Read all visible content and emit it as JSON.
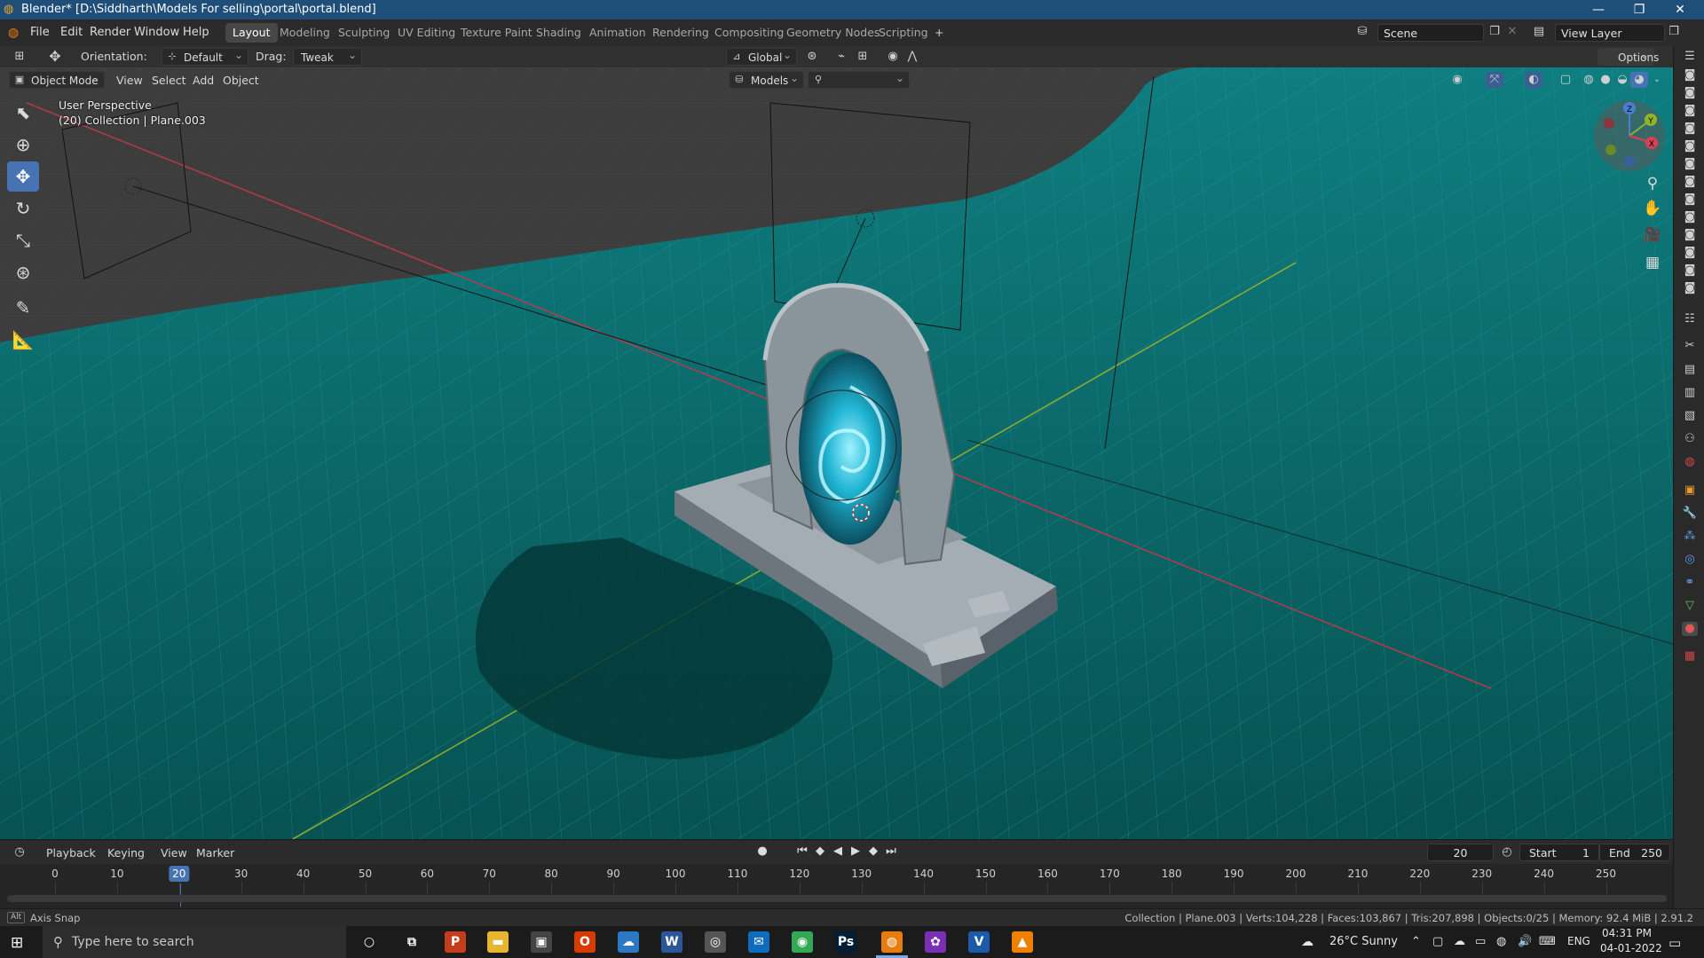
{
  "window": {
    "title": "Blender* [D:\\Siddharth\\Models For selling\\portal\\portal.blend]",
    "controls": [
      "—",
      "❐",
      "✕"
    ]
  },
  "menu": [
    "File",
    "Edit",
    "Render",
    "Window",
    "Help"
  ],
  "workspaces": [
    "Layout",
    "Modeling",
    "Sculpting",
    "UV Editing",
    "Texture Paint",
    "Shading",
    "Animation",
    "Rendering",
    "Compositing",
    "Geometry Nodes",
    "Scripting",
    "+"
  ],
  "active_workspace": "Layout",
  "scene": {
    "name": "Scene",
    "view_layer": "View Layer"
  },
  "header": {
    "orientation_label": "Orientation:",
    "orientation_value": "Default",
    "drag_label": "Drag:",
    "drag_value": "Tweak",
    "transform_space": "Global",
    "options": "Options"
  },
  "viewport_header": {
    "mode": "Object Mode",
    "menus": [
      "View",
      "Select",
      "Add",
      "Object"
    ],
    "collection_filter": "Models"
  },
  "viewport": {
    "view_name": "User Perspective",
    "context": "(20) Collection | Plane.003",
    "floor_color": "#0b6b6b",
    "background_color": "#3d3d3d",
    "portal_glow_color": "#33c6e0",
    "stone_color": "#8f9aa0"
  },
  "gizmo": {
    "x": "X",
    "y": "Y",
    "z": "Z"
  },
  "timeline": {
    "menus": [
      "Playback",
      "Keying",
      "View",
      "Marker"
    ],
    "current_frame": "20",
    "start_label": "Start",
    "start": "1",
    "end_label": "End",
    "end": "250",
    "ticks": [
      "0",
      "10",
      "20",
      "30",
      "40",
      "50",
      "60",
      "70",
      "80",
      "90",
      "100",
      "110",
      "120",
      "130",
      "140",
      "150",
      "160",
      "170",
      "180",
      "190",
      "200",
      "210",
      "220",
      "230",
      "240",
      "250"
    ]
  },
  "status": {
    "left_key": "Alt",
    "left": "Axis Snap",
    "right": "Collection | Plane.003 | Verts:104,228 | Faces:103,867 | Tris:207,898 | Objects:0/25 | Memory: 92.4 MiB | 2.91.2"
  },
  "taskbar": {
    "search_placeholder": "Type here to search",
    "apps": [
      {
        "name": "cortana-icon",
        "glyph": "○",
        "color": "#1b1b1b"
      },
      {
        "name": "task-view-icon",
        "glyph": "⧉",
        "color": "#1b1b1b"
      },
      {
        "name": "powerpoint-icon",
        "glyph": "P",
        "color": "#c43e1c"
      },
      {
        "name": "file-explorer-icon",
        "glyph": "▬",
        "color": "#e8b530"
      },
      {
        "name": "store-icon",
        "glyph": "▣",
        "color": "#444444"
      },
      {
        "name": "office-icon",
        "glyph": "O",
        "color": "#d83b01"
      },
      {
        "name": "feedback-icon",
        "glyph": "☁",
        "color": "#2b79c2"
      },
      {
        "name": "word-icon",
        "glyph": "W",
        "color": "#2b579a"
      },
      {
        "name": "app-icon",
        "glyph": "◎",
        "color": "#555555"
      },
      {
        "name": "mail-icon",
        "glyph": "✉",
        "color": "#0f6cbd"
      },
      {
        "name": "chrome-icon",
        "glyph": "◉",
        "color": "#34a853"
      },
      {
        "name": "photoshop-icon",
        "glyph": "Ps",
        "color": "#001e36"
      },
      {
        "name": "blender-icon",
        "glyph": "◍",
        "color": "#e87d0d"
      },
      {
        "name": "app2-icon",
        "glyph": "✿",
        "color": "#7a2fb5"
      },
      {
        "name": "vector-icon",
        "glyph": "V",
        "color": "#1b5aa8"
      },
      {
        "name": "vlc-icon",
        "glyph": "▲",
        "color": "#f08000"
      }
    ],
    "weather": "26°C  Sunny",
    "lang": "ENG",
    "time": "04:31 PM",
    "date": "04-01-2022"
  }
}
